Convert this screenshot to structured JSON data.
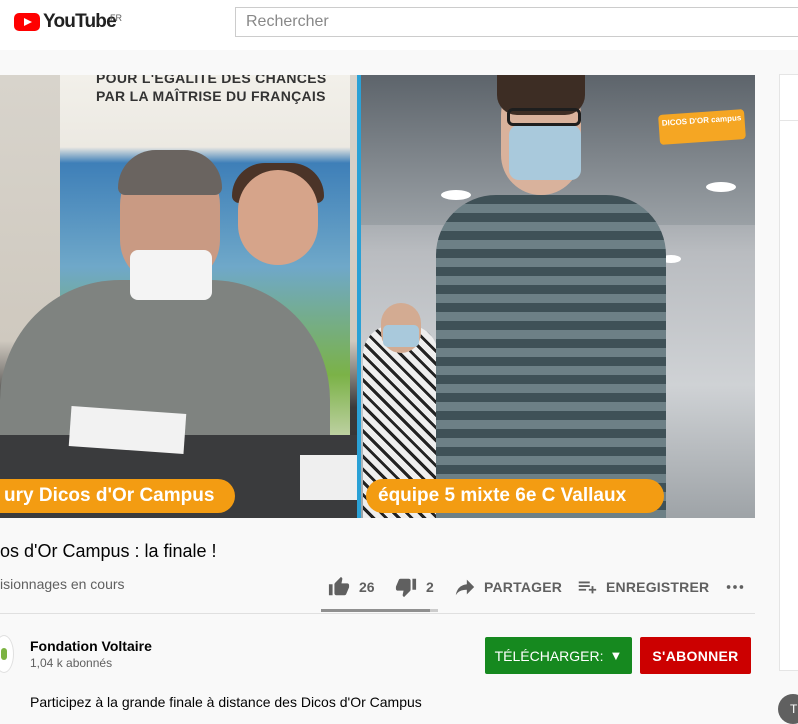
{
  "header": {
    "logo_text": "YouTube",
    "region": "FR",
    "search_placeholder": "Rechercher"
  },
  "video": {
    "banner_text": "POUR L'ÉGALITÉ DES CHANCES PAR LA MAÎTRISE DU FRANÇAIS",
    "caption_left": "ury Dicos d'Or Campus",
    "caption_right": "équipe 5 mixte 6e C Vallaux",
    "badge_text": "DICOS D'OR campus"
  },
  "info": {
    "title": "os d'Or Campus : la finale !",
    "views": "isionnages en cours"
  },
  "actions": {
    "likes": "26",
    "dislikes": "2",
    "share_label": "PARTAGER",
    "save_label": "ENREGISTRER",
    "like_ratio": 0.93
  },
  "channel": {
    "name": "Fondation Voltaire",
    "subscribers": "1,04 k abonnés",
    "download_label": "TÉLÉCHARGER:",
    "download_arrow": "▼",
    "subscribe_label": "S'ABONNER",
    "description": "Participez à la grande finale à distance des Dicos d'Or Campus"
  },
  "side": {
    "chip_text": "T"
  },
  "colors": {
    "brand_red": "#ff0000",
    "subscribe_red": "#cc0000",
    "download_green": "#16891f",
    "caption_orange": "#f39c12"
  }
}
